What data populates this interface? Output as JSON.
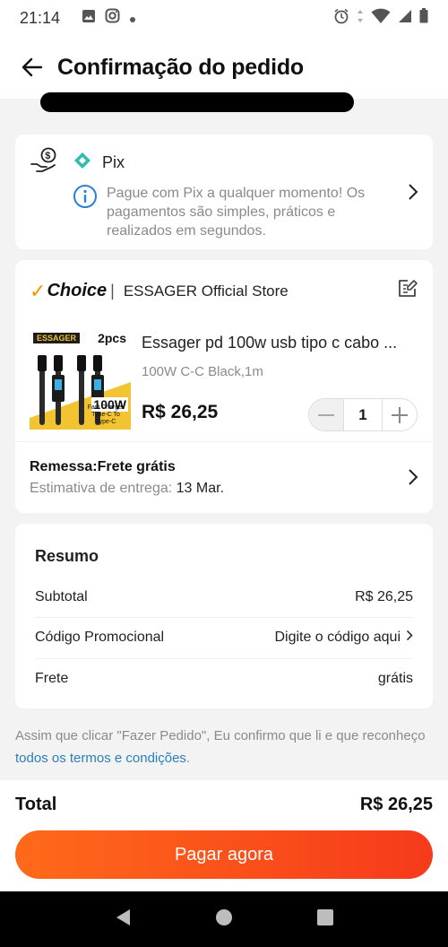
{
  "status_bar": {
    "time": "21:14"
  },
  "header": {
    "title": "Confirmação do pedido"
  },
  "payment": {
    "method": "Pix",
    "info": "Pague com Pix a qualquer momento! Os pagamentos são simples, práticos e realizados em segundos."
  },
  "store": {
    "choice_label": "Choice",
    "name": "ESSAGER Official Store"
  },
  "product": {
    "title": "Essager pd 100w usb tipo c cabo ...",
    "variant": "100W C-C Black,1m",
    "price": "R$ 26,25",
    "quantity": "1",
    "image_texts": {
      "brand": "ESSAGER",
      "pcs": "2pcs",
      "watt": "100W",
      "desc": "Fast Charger Type-C To Type-C"
    }
  },
  "shipping": {
    "title": "Remessa:Frete grátis",
    "estimate_label": "Estimativa de entrega:",
    "estimate_date": "13 Mar."
  },
  "summary": {
    "title": "Resumo",
    "rows": [
      {
        "label": "Subtotal",
        "value": "R$ 26,25"
      },
      {
        "label": "Código Promocional",
        "value": "Digite o código aqui"
      },
      {
        "label": "Frete",
        "value": "grátis"
      }
    ]
  },
  "terms": {
    "text": "Assim que clicar \"Fazer Pedido\", Eu confirmo que li e que reconheço ",
    "link": "todos os termos e condições",
    "end": "."
  },
  "footer": {
    "total_label": "Total",
    "total_value": "R$ 26,25",
    "pay_button": "Pagar agora"
  },
  "colors": {
    "accent": "#f63a1b",
    "link": "#2a7fb8",
    "pix": "#32bcad",
    "choice_check": "#f39800"
  }
}
